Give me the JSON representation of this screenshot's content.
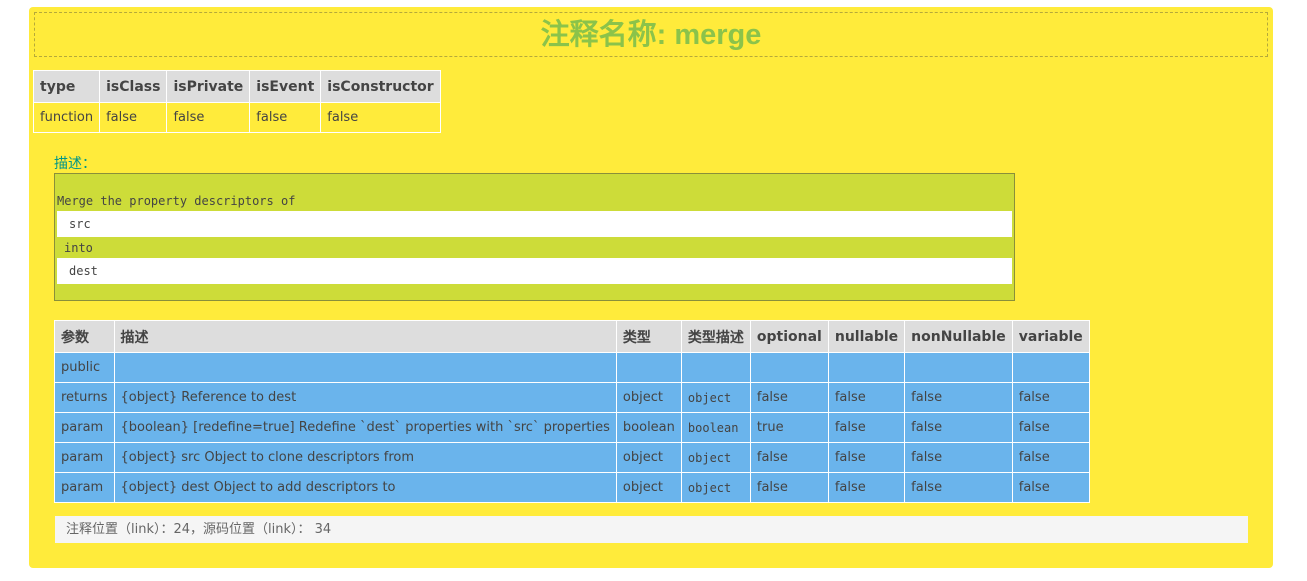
{
  "title": "注释名称: merge",
  "meta": {
    "headers": [
      "type",
      "isClass",
      "isPrivate",
      "isEvent",
      "isConstructor"
    ],
    "values": [
      "function",
      "false",
      "false",
      "false",
      "false"
    ]
  },
  "description": {
    "label": "描述：",
    "line1": "Merge the property descriptors of",
    "code1": "src",
    "line2": "into",
    "code2": "dest"
  },
  "params": {
    "headers": [
      "参数",
      "描述",
      "类型",
      "类型描述",
      "optional",
      "nullable",
      "nonNullable",
      "variable"
    ],
    "rows": [
      [
        "public",
        "",
        "",
        "",
        "",
        "",
        "",
        ""
      ],
      [
        "returns",
        "{object} Reference to dest",
        "object",
        "object",
        "false",
        "false",
        "false",
        "false"
      ],
      [
        "param",
        "{boolean} [redefine=true] Redefine `dest` properties with `src` properties",
        "boolean",
        "boolean",
        "true",
        "false",
        "false",
        "false"
      ],
      [
        "param",
        "{object} src Object to clone descriptors from",
        "object",
        "object",
        "false",
        "false",
        "false",
        "false"
      ],
      [
        "param",
        "{object} dest Object to add descriptors to",
        "object",
        "object",
        "false",
        "false",
        "false",
        "false"
      ]
    ]
  },
  "footer": "注释位置（link）：24，源码位置（link）： 34",
  "colors": {
    "panel": "#ffeb3b",
    "title": "#8bc34a",
    "desc_box": "#cddc39",
    "param_row": "#6ab4ec",
    "header_bg": "#dddddd",
    "desc_label": "#009688"
  }
}
